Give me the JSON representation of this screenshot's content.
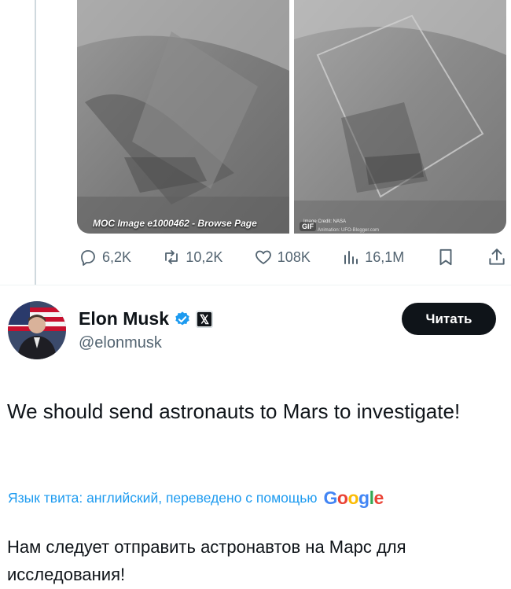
{
  "media": {
    "left_caption": "MOC Image e1000462 - Browse Page",
    "right_credit": "Image Credit: NASA",
    "right_gif_badge": "GIF",
    "right_source": "Animation: UFO-Blogger.com"
  },
  "actions": {
    "replies": "6,2K",
    "retweets": "10,2K",
    "likes": "108K",
    "views": "16,1M"
  },
  "author": {
    "name": "Elon Musk",
    "handle": "@elonmusk",
    "follow_label": "Читать"
  },
  "tweet": {
    "text": "We should send astronauts to Mars to investigate!",
    "translation_label": "Язык твита: английский, переведено с помощью",
    "translation_provider": "Google",
    "translated_text": "Нам следует отправить астронавтов на Марс для исследования!"
  },
  "colors": {
    "accent": "#1d9bf0",
    "text_secondary": "#536471",
    "button_bg": "#0f1419"
  }
}
